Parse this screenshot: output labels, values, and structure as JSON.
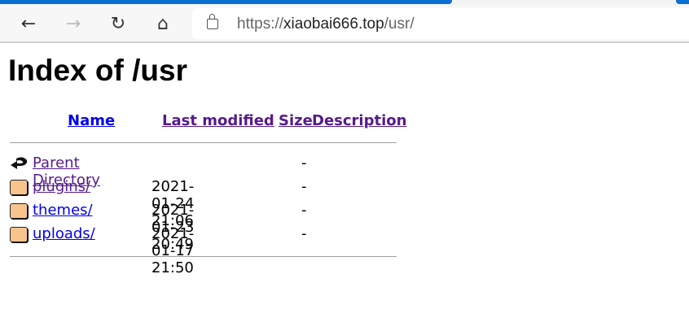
{
  "browser": {
    "url_scheme": "https://",
    "url_host": "xiaobai666.top",
    "url_path": "/usr/"
  },
  "page": {
    "title": "Index of /usr"
  },
  "table": {
    "headers": {
      "name": "Name",
      "last_modified": "Last modified",
      "size": "Size",
      "description": "Description"
    },
    "rows": [
      {
        "name": "Parent Directory",
        "date": "",
        "size": "-",
        "icon": "back-icon"
      },
      {
        "name": "plugins/",
        "date": "2021-01-24 21:06",
        "size": "-",
        "icon": "folder-icon"
      },
      {
        "name": "themes/",
        "date": "2021-01-23 20:49",
        "size": "-",
        "icon": "folder-icon"
      },
      {
        "name": "uploads/",
        "date": "2021-01-17 21:50",
        "size": "-",
        "icon": "folder-icon"
      }
    ]
  }
}
